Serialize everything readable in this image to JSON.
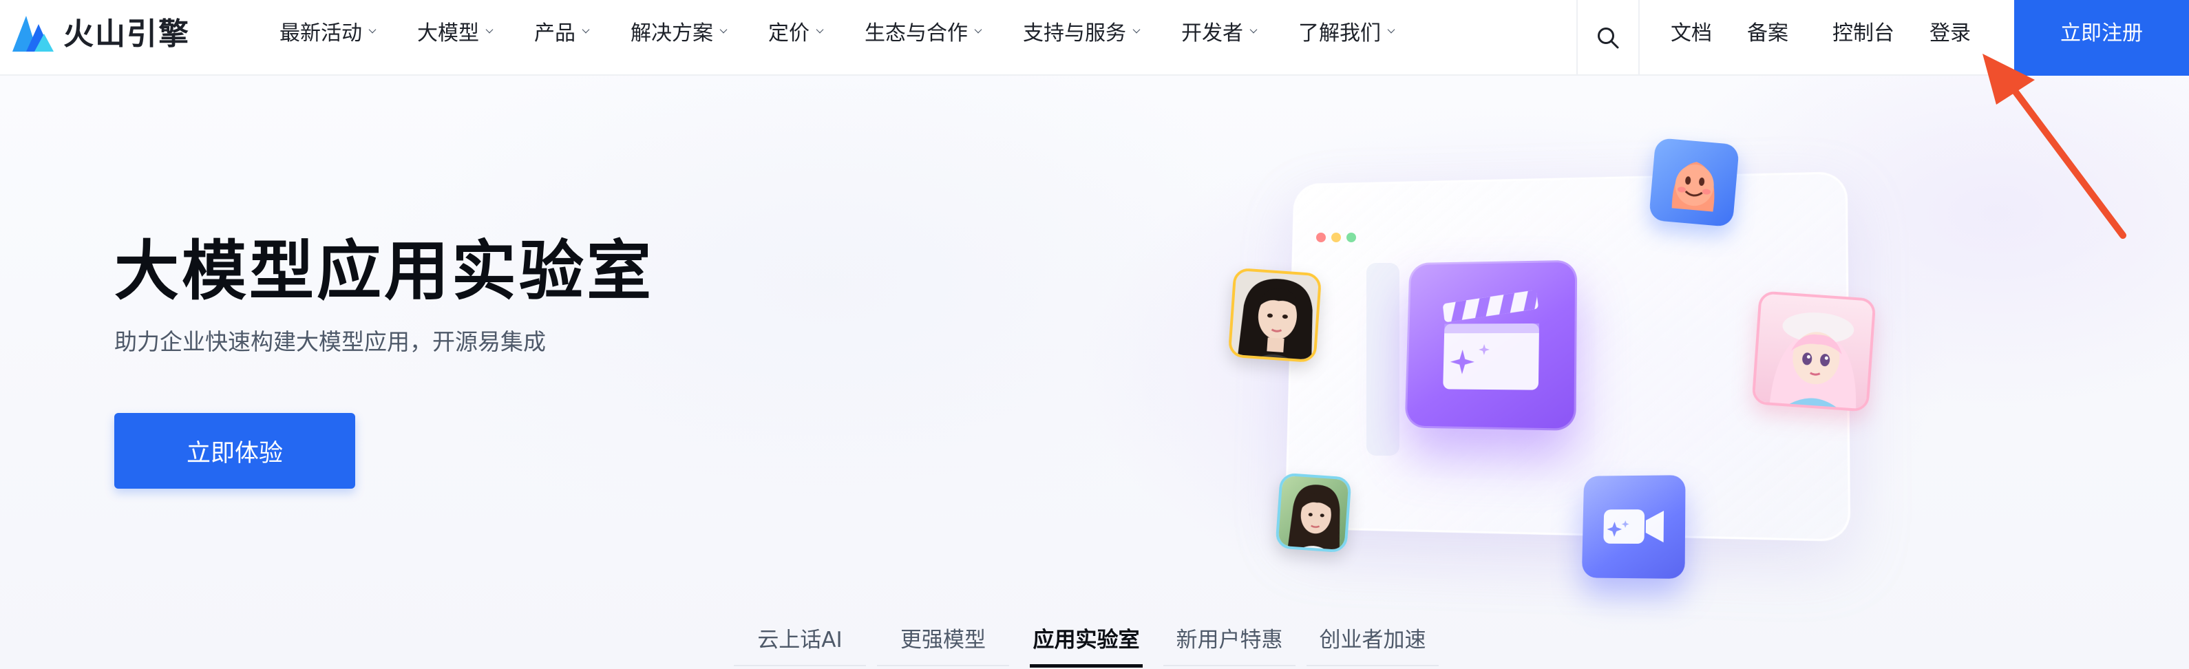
{
  "header": {
    "logo_text": "火山引擎",
    "nav": [
      {
        "label": "最新活动"
      },
      {
        "label": "大模型"
      },
      {
        "label": "产品"
      },
      {
        "label": "解决方案"
      },
      {
        "label": "定价"
      },
      {
        "label": "生态与合作"
      },
      {
        "label": "支持与服务"
      },
      {
        "label": "开发者"
      },
      {
        "label": "了解我们"
      }
    ],
    "search_icon": "search-icon",
    "links": {
      "docs": "文档",
      "filing": "备案",
      "console": "控制台",
      "login": "登录"
    },
    "register_label": "立即注册",
    "accent_color": "#2468f2"
  },
  "hero": {
    "title": "大模型应用实验室",
    "subtitle": "助力企业快速构建大模型应用，开源易集成",
    "cta_label": "立即体验",
    "illustration_icons": [
      "clapperboard-icon",
      "video-camera-icon",
      "avatar-image",
      "mascot-image"
    ]
  },
  "tabs": {
    "items": [
      {
        "label": "云上话AI"
      },
      {
        "label": "更强模型"
      },
      {
        "label": "应用实验室"
      },
      {
        "label": "新用户特惠"
      },
      {
        "label": "创业者加速"
      }
    ],
    "active_index": 2
  },
  "annotation": {
    "arrow_color": "#f0502d"
  }
}
